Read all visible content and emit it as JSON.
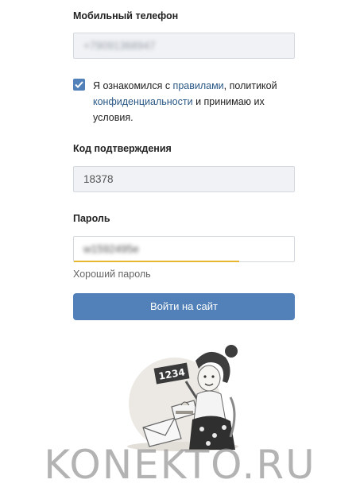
{
  "phone": {
    "label": "Мобильный телефон",
    "value": "+79091368947"
  },
  "agreement": {
    "checked": true,
    "text_1": "Я ознакомился с ",
    "link_rules": "правилами",
    "text_2": ", политикой ",
    "link_privacy": "конфиденциальности",
    "text_3": " и принимаю их условия."
  },
  "code": {
    "label": "Код подтверждения",
    "value": "18378"
  },
  "password": {
    "label": "Пароль",
    "value": "w1592495e",
    "strength_text": "Хороший пароль"
  },
  "submit": {
    "label": "Войти на сайт"
  },
  "illustration": {
    "sign_text": "1234"
  },
  "watermark": {
    "text": "KONEKTO.RU"
  },
  "colors": {
    "accent": "#5181b8",
    "link": "#2a5885",
    "strength": "#e6b630",
    "field_bg": "#f0f2f5"
  }
}
